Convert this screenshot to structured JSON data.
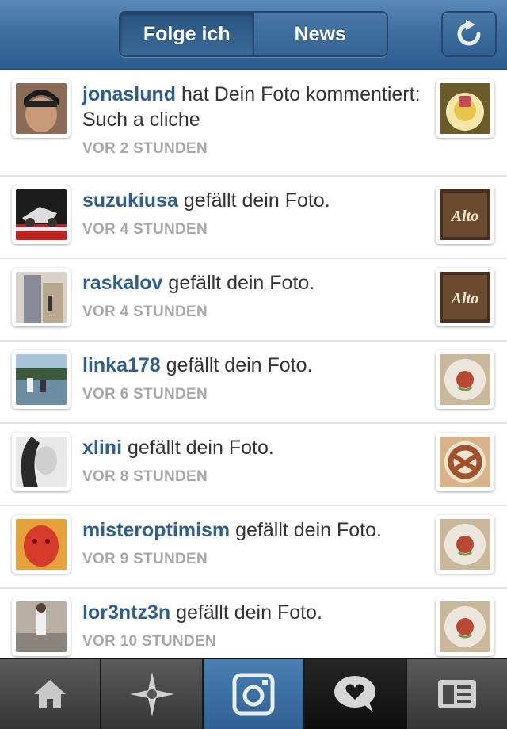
{
  "header": {
    "segments": [
      "Folge ich",
      "News"
    ],
    "active_segment": "Folge ich",
    "refresh_icon": "refresh-icon"
  },
  "feed": [
    {
      "username": "jonaslund",
      "action": " hat Dein Foto kommentiert: Such a cliche",
      "time": "VOR 2 STUNDEN",
      "avatar": "avatar-jonaslund",
      "thumb": "food-plate"
    },
    {
      "username": "suzukiusa",
      "action": " gefällt dein Foto.",
      "time": "VOR 4 STUNDEN",
      "avatar": "avatar-suzukiusa",
      "thumb": "alto-sign"
    },
    {
      "username": "raskalov",
      "action": " gefällt dein Foto.",
      "time": "VOR 4 STUNDEN",
      "avatar": "avatar-raskalov",
      "thumb": "alto-sign"
    },
    {
      "username": "linka178",
      "action": " gefällt dein Foto.",
      "time": "VOR 6 STUNDEN",
      "avatar": "avatar-linka178",
      "thumb": "plate-tomato"
    },
    {
      "username": "xlini",
      "action": " gefällt dein Foto.",
      "time": "VOR 8 STUNDEN",
      "avatar": "avatar-xlini",
      "thumb": "pretzel"
    },
    {
      "username": "misteroptimism",
      "action": " gefällt dein Foto.",
      "time": "VOR 9 STUNDEN",
      "avatar": "avatar-misteroptimism",
      "thumb": "plate-tomato"
    },
    {
      "username": "lor3ntz3n",
      "action": " gefällt dein Foto.",
      "time": "VOR 10 STUNDEN",
      "avatar": "avatar-lor3ntz3n",
      "thumb": "plate-tomato"
    }
  ],
  "thumb_labels": {
    "alto": "Alto"
  },
  "tabbar": {
    "tabs": [
      "home-icon",
      "explore-icon",
      "camera-icon",
      "news-icon",
      "profile-icon"
    ],
    "selected": "camera-icon"
  },
  "colors": {
    "header": "#3e6f9f",
    "username": "#2f5f8a",
    "time": "#a8a8a8"
  }
}
